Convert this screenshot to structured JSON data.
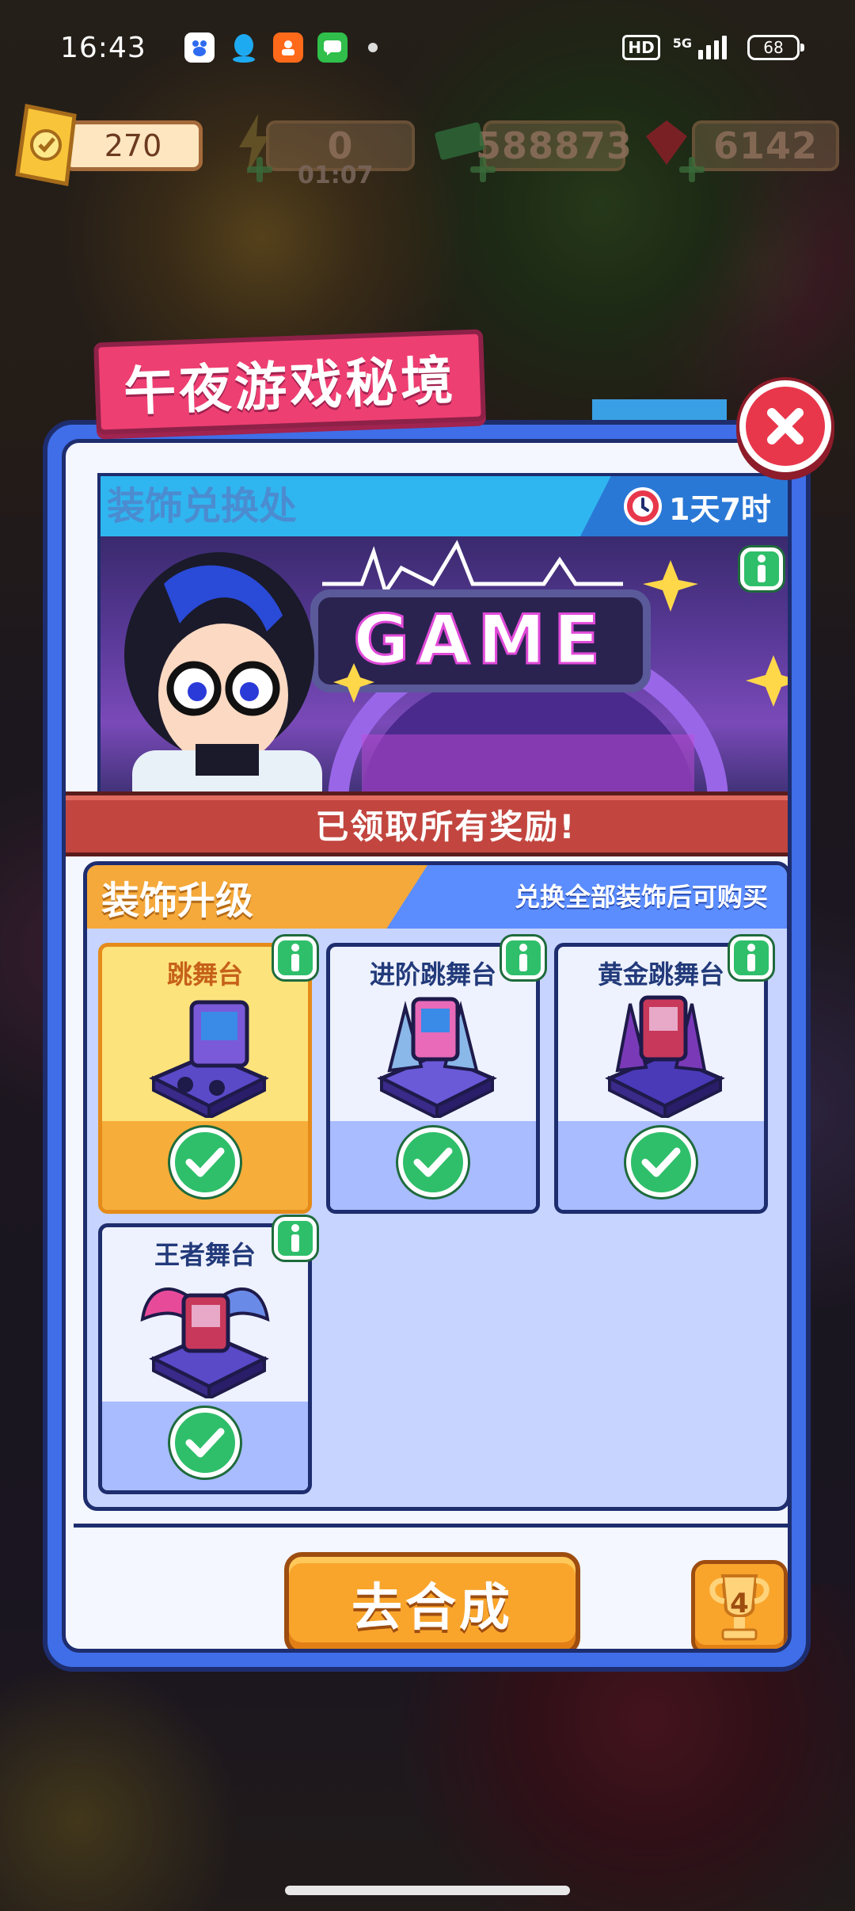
{
  "status_bar": {
    "time": "16:43",
    "hd": "HD",
    "network": "5G",
    "battery": "68",
    "notification_icons": [
      "baidu-app-icon",
      "qq-icon",
      "taobao-app-icon",
      "wechat-icon"
    ]
  },
  "resources": {
    "tickets": "270",
    "energy": "0",
    "energy_timer": "01:07",
    "cash": "588873",
    "gems": "6142"
  },
  "dialog": {
    "title": "午夜游戏秘境",
    "exchange_title": "装饰兑换处",
    "timer": "1天7时",
    "banner_text": "GAME",
    "claimed_text": "已领取所有奖励!",
    "upgrade_title": "装饰升级",
    "upgrade_hint": "兑换全部装饰后可购买",
    "cards": [
      {
        "name": "跳舞台",
        "selected": true,
        "claimed": true
      },
      {
        "name": "进阶跳舞台",
        "selected": false,
        "claimed": true
      },
      {
        "name": "黄金跳舞台",
        "selected": false,
        "claimed": true
      },
      {
        "name": "王者舞台",
        "selected": false,
        "claimed": true
      }
    ],
    "merge_button": "去合成",
    "trophy_count": "4"
  },
  "colors": {
    "dialog_blue": "#3f6ee8",
    "title_pink": "#ee3f72",
    "button_orange": "#f9a52c",
    "check_green": "#2fbf6a",
    "claimed_red": "#c2463f"
  }
}
